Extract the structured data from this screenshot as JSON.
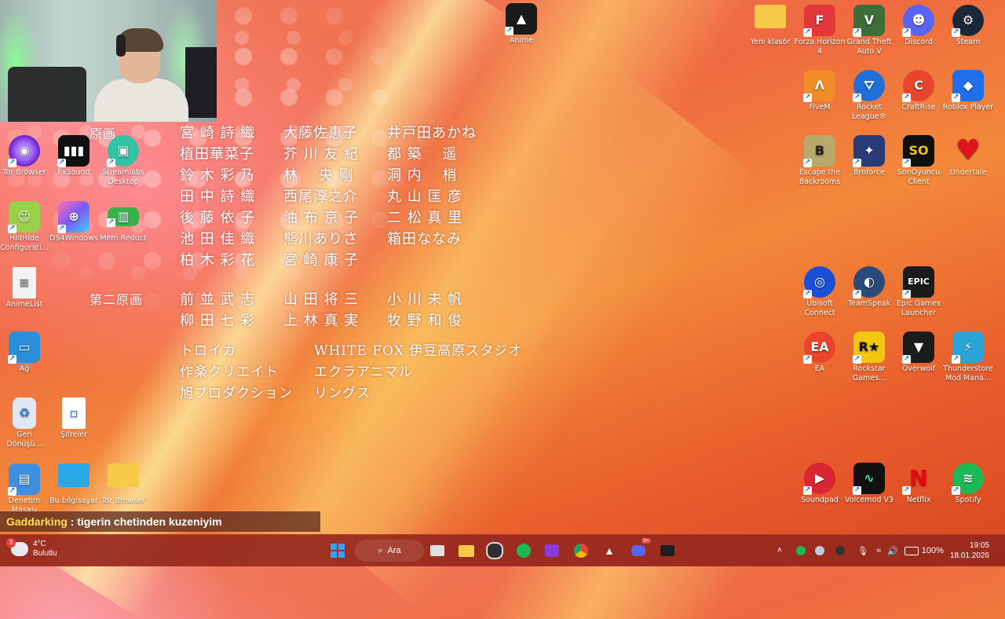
{
  "webcam": {
    "description": ""
  },
  "desktop_left_icons": [
    {
      "id": "tor-browser-top",
      "label": "Tor Browser",
      "icon": "tor-icon",
      "color": "#7b2fd6"
    },
    {
      "id": "fxsound",
      "label": "FxSound",
      "icon": "fxsound-icon",
      "color": "#111111"
    },
    {
      "id": "streamlabs",
      "label": "Streamlabs Desktop",
      "icon": "streamlabs-icon",
      "color": "#31c3a2"
    },
    {
      "id": "hidhide",
      "label": "HidHide Configurati...",
      "icon": "hidhide-icon",
      "color": "#9ad14b"
    },
    {
      "id": "ds4windows",
      "label": "DS4Windows",
      "icon": "gamepad-icon",
      "color": "#7a5af8"
    },
    {
      "id": "memreduct",
      "label": "Mem Reduct",
      "icon": "memory-icon",
      "color": "#35b34a"
    },
    {
      "id": "animelist",
      "label": "AnimeList",
      "icon": "text-file-icon",
      "color": "#f0f0f0"
    },
    {
      "id": "ag",
      "label": "Ağ",
      "icon": "network-icon",
      "color": "#2a8fd8"
    },
    {
      "id": "recycle",
      "label": "Geri Dönüşü...",
      "icon": "recycle-bin-icon",
      "color": "#dfe8f2"
    },
    {
      "id": "sifreler",
      "label": "Şifreler",
      "icon": "text-file-icon",
      "color": "#ffffff"
    },
    {
      "id": "control-panel",
      "label": "Denetim Masası",
      "icon": "control-panel-icon",
      "color": "#3f8fe0"
    },
    {
      "id": "this-pc",
      "label": "Bu bilgisayar",
      "icon": "monitor-icon",
      "color": "#29a9e8"
    },
    {
      "id": "tor-browser-folder",
      "label": "Tor Browser",
      "icon": "folder-icon",
      "color": "#f7c948"
    }
  ],
  "desktop_top_icons": [
    {
      "id": "anime-app",
      "label": "Anime",
      "icon": "anime-app-icon",
      "color": "#1a1a1a"
    }
  ],
  "desktop_right_icons": [
    {
      "id": "yeni-klasor",
      "label": "Yeni klasör",
      "icon": "folder-icon",
      "color": "#f7c948"
    },
    {
      "id": "forza",
      "label": "Forza Horizon 4",
      "icon": "forza-icon",
      "color": "#e2373b"
    },
    {
      "id": "gta",
      "label": "Grand Theft Auto V",
      "icon": "gta-icon",
      "color": "#3d6e3a"
    },
    {
      "id": "discord",
      "label": "Discord",
      "icon": "discord-icon",
      "color": "#5865f2"
    },
    {
      "id": "steam",
      "label": "Steam",
      "icon": "steam-icon",
      "color": "#1b2838"
    },
    {
      "id": "fivem",
      "label": "FiveM",
      "icon": "fivem-icon",
      "color": "#f28c28"
    },
    {
      "id": "rocket-league",
      "label": "Rocket League®",
      "icon": "rocket-league-icon",
      "color": "#1e6fd9"
    },
    {
      "id": "craftrise",
      "label": "CraftRise",
      "icon": "craftrise-icon",
      "color": "#e8462c"
    },
    {
      "id": "roblox",
      "label": "Roblox Player",
      "icon": "roblox-icon",
      "color": "#1f6feb"
    },
    {
      "id": "escape-backrooms",
      "label": "Escape the Backrooms",
      "icon": "backrooms-icon",
      "color": "#b9a96b"
    },
    {
      "id": "broforce",
      "label": "Broforce",
      "icon": "broforce-icon",
      "color": "#2a3b7a"
    },
    {
      "id": "sonoyuncu",
      "label": "SonOyuncu Client",
      "icon": "sonoyuncu-icon",
      "color": "#101010"
    },
    {
      "id": "undertale",
      "label": "Undertale",
      "icon": "heart-icon",
      "color": "#e0141c"
    },
    {
      "id": "ubisoft",
      "label": "Ubisoft Connect",
      "icon": "ubisoft-icon",
      "color": "#1b4fd6"
    },
    {
      "id": "teamspeak",
      "label": "TeamSpeak",
      "icon": "teamspeak-icon",
      "color": "#2b4a7a"
    },
    {
      "id": "epic",
      "label": "Epic Games Launcher",
      "icon": "epic-icon",
      "color": "#1b1b1b"
    },
    {
      "id": "ea",
      "label": "EA",
      "icon": "ea-icon",
      "color": "#e8462c"
    },
    {
      "id": "rockstar",
      "label": "Rockstar Games...",
      "icon": "rockstar-icon",
      "color": "#f3c614"
    },
    {
      "id": "overwolf",
      "label": "Overwolf",
      "icon": "overwolf-icon",
      "color": "#1c1c1c"
    },
    {
      "id": "thunderstore",
      "label": "Thunderstore Mod Mana...",
      "icon": "thunderstore-icon",
      "color": "#2aa3d6"
    },
    {
      "id": "soundpad",
      "label": "Soundpad",
      "icon": "soundpad-icon",
      "color": "#d92631"
    },
    {
      "id": "voicemod",
      "label": "Voicemod V3",
      "icon": "voicemod-icon",
      "color": "#111111"
    },
    {
      "id": "netflix",
      "label": "Netflix",
      "icon": "netflix-icon",
      "color": "#000000"
    },
    {
      "id": "spotify",
      "label": "Spotify",
      "icon": "spotify-icon",
      "color": "#1db954"
    }
  ],
  "credits": {
    "label_gengaa": "原画",
    "label_second": "第二原画",
    "gengaa_rows": [
      [
        "宮 崎 詩 織",
        "大藤佐恵子",
        "井戸田あかね"
      ],
      [
        "植田華菜子",
        "芥 川 友 紀",
        "都 築 　遥"
      ],
      [
        "鈴 木 彩 乃",
        "林 　央 剛",
        "洞 内 　梢"
      ],
      [
        "田 中 詩 織",
        "西尾淳之介",
        "丸 山 匡 彦"
      ],
      [
        "後 藤 依 子",
        "油 布 京 子",
        "二 松 真 里"
      ],
      [
        "池 田 佳 織",
        "熊川ありさ",
        "箱田ななみ"
      ],
      [
        "柏 木 彩 花",
        "宮 崎 康 子",
        ""
      ]
    ],
    "second_rows": [
      [
        "前 並 武 志",
        "山 田 将 三",
        "小 川 未 帆"
      ],
      [
        "柳 田 七 彩",
        "上 林 真 実",
        "牧 野 和 俊"
      ]
    ],
    "studios_left": [
      "トロイカ",
      "作楽クリエイト",
      "旭プロダクション"
    ],
    "studios_right": [
      "WHITE FOX 伊豆高原スタジオ",
      "エクラアニマル",
      "リングス"
    ]
  },
  "chat": {
    "user": "Gaddarking",
    "separator": " : ",
    "message": "tigerin chetinden kuzeniyim"
  },
  "taskbar": {
    "weather": {
      "temp": "4°C",
      "condition": "Bulutlu",
      "badge": "3"
    },
    "search_label": "Ara",
    "apps": [
      {
        "id": "start",
        "icon": "windows-icon",
        "color": "#3aa0ff"
      },
      {
        "id": "task-view",
        "icon": "task-view-icon",
        "color": "#e0e0e0"
      },
      {
        "id": "explorer",
        "icon": "folder-icon",
        "color": "#f7c948"
      },
      {
        "id": "obs",
        "icon": "obs-icon",
        "color": "#302e31"
      },
      {
        "id": "spotify",
        "icon": "spotify-icon",
        "color": "#1db954"
      },
      {
        "id": "clapper",
        "icon": "clapper-icon",
        "color": "#8a3ad6"
      },
      {
        "id": "chrome",
        "icon": "chrome-icon",
        "color": "#e8453c"
      },
      {
        "id": "anime",
        "icon": "anime-app-icon",
        "color": "#111111"
      },
      {
        "id": "discord",
        "icon": "discord-icon",
        "color": "#5865f2",
        "badge": "9+"
      },
      {
        "id": "terminal",
        "icon": "terminal-icon",
        "color": "#1e1e1e"
      }
    ],
    "tray": {
      "battery": "100%",
      "time": "19:05",
      "date": "18.01.2026"
    }
  }
}
